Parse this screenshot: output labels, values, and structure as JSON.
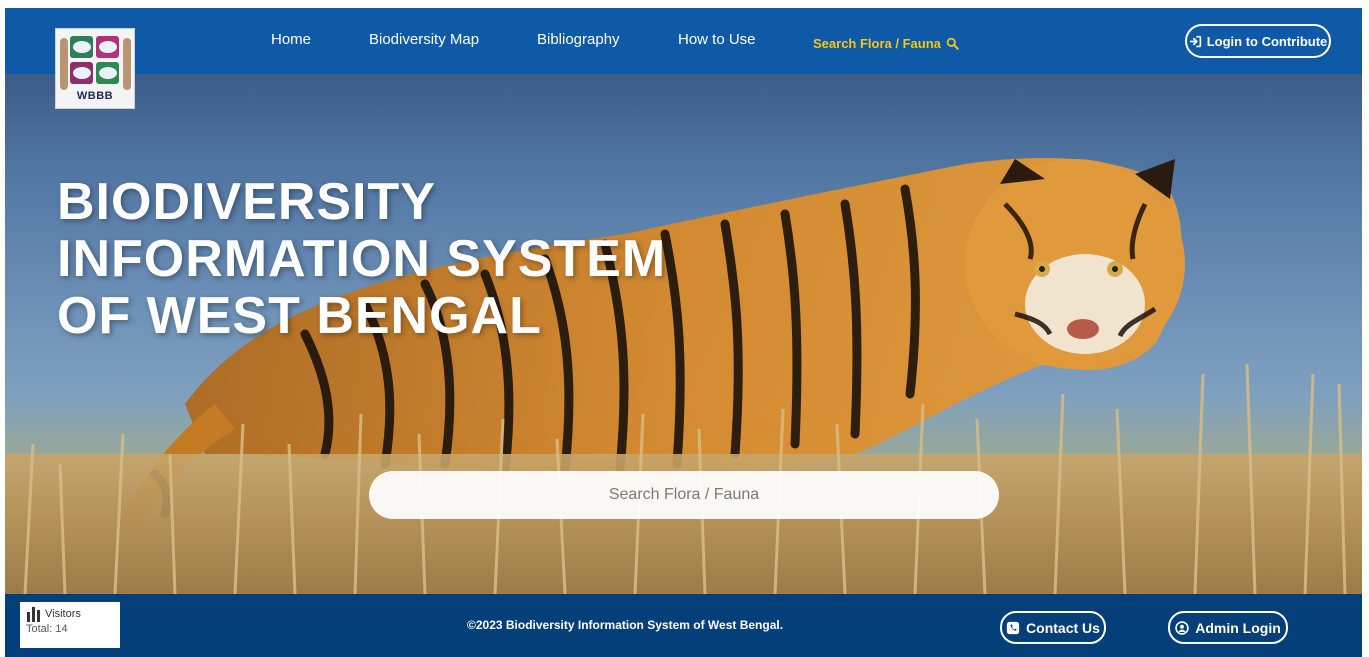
{
  "brand": {
    "logo_text": "WBBB"
  },
  "nav": {
    "items": [
      {
        "label": "Home"
      },
      {
        "label": "Biodiversity Map"
      },
      {
        "label": "Bibliography"
      },
      {
        "label": "How to Use"
      }
    ],
    "search_label": "Search Flora / Fauna",
    "search_icon": "search-icon",
    "login_label": "Login to Contribute",
    "login_icon": "sign-in-icon"
  },
  "hero": {
    "title_lines": [
      "BIODIVERSITY",
      "INFORMATION SYSTEM",
      "OF WEST BENGAL"
    ],
    "search_placeholder": "Search Flora / Fauna"
  },
  "footer": {
    "visitors_label": "Visitors",
    "visitors_total": "Total: 14",
    "copyright": "©2023 Biodiversity Information System of West Bengal.",
    "contact_label": "Contact Us",
    "admin_label": "Admin Login"
  },
  "colors": {
    "nav_bg": "#0f5aa6",
    "footer_bg": "#053f7a",
    "accent": "#f5c518"
  }
}
